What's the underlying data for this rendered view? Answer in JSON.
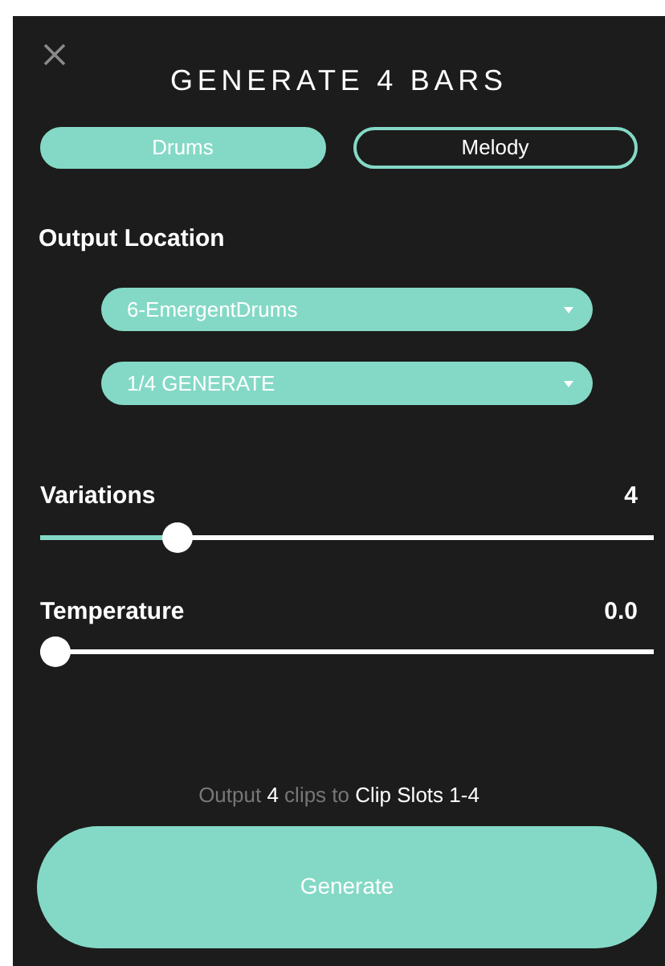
{
  "title": "GENERATE 4 BARS",
  "tabs": [
    {
      "label": "Drums",
      "selected": true
    },
    {
      "label": "Melody",
      "selected": false
    }
  ],
  "output_location": {
    "label": "Output Location",
    "dropdowns": [
      "6-EmergentDrums",
      "1/4 GENERATE"
    ]
  },
  "sliders": [
    {
      "label": "Variations",
      "reading": "4",
      "level": 0.21
    },
    {
      "label": "Temperature",
      "reading": "0.0",
      "level": 0
    }
  ],
  "summary": "Output **4** clips to **Clip Slots 1-4**",
  "generate_button": "Generate"
}
